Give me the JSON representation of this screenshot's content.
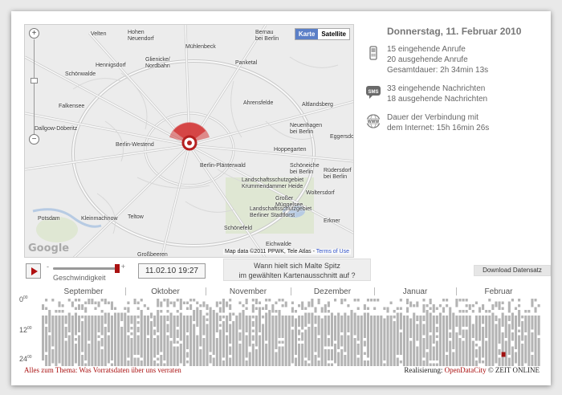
{
  "map": {
    "type_buttons": {
      "map": "Karte",
      "satellite": "Satellite"
    },
    "zoom": {
      "in": "+",
      "out": "−"
    },
    "logo": "Google",
    "attribution": "Map data ©2011 PPWK, Tele Atlas - ",
    "terms": "Terms of Use",
    "labels": [
      {
        "id": "velten",
        "text": "Velten"
      },
      {
        "id": "neuendorf",
        "text": "Hohen\nNeuendorf"
      },
      {
        "id": "muehlenbeck",
        "text": "Mühlenbeck"
      },
      {
        "id": "bernau",
        "text": "Bernau\nbei Berlin"
      },
      {
        "id": "hennigsdorf",
        "text": "Hennigsdorf"
      },
      {
        "id": "glienicke",
        "text": "Glienicke/\nNordbahn"
      },
      {
        "id": "panketal",
        "text": "Panketal"
      },
      {
        "id": "schoenwalde",
        "text": "Schönwalde"
      },
      {
        "id": "falkensee",
        "text": "Falkensee"
      },
      {
        "id": "ahrensfelde",
        "text": "Ahrensfelde"
      },
      {
        "id": "altlandsberg",
        "text": "Altlandsberg"
      },
      {
        "id": "dallgow",
        "text": "Dallgow-Döberitz"
      },
      {
        "id": "berlinwestend",
        "text": "Berlin-Westend"
      },
      {
        "id": "neuenhagen",
        "text": "Neuenhagen\nbei Berlin"
      },
      {
        "id": "eggersdorf",
        "text": "Eggersdo..."
      },
      {
        "id": "hoppegarten",
        "text": "Hoppegarten"
      },
      {
        "id": "plaenterwald",
        "text": "Berlin-Plänterwald"
      },
      {
        "id": "schoeneiche",
        "text": "Schöneiche\nbei Berlin"
      },
      {
        "id": "ruedersdorf",
        "text": "Rüdersdorf\nbei Berlin"
      },
      {
        "id": "krummendammer",
        "text": "Landschaftsschutzgebiet\nKrummendammer Heide"
      },
      {
        "id": "woltersdorf",
        "text": "Woltersdorf"
      },
      {
        "id": "mueggelsee",
        "text": "Großer\nMüggelsee"
      },
      {
        "id": "potsdam",
        "text": "Potsdam"
      },
      {
        "id": "kleinmachnow",
        "text": "Kleinmachnow"
      },
      {
        "id": "teltow",
        "text": "Teltow"
      },
      {
        "id": "stadtforst",
        "text": "Landschaftsschutzgebiet\nBerliner Stadtforst"
      },
      {
        "id": "erkner",
        "text": "Erkner"
      },
      {
        "id": "schoenefeld",
        "text": "Schönefeld"
      },
      {
        "id": "eichwalde",
        "text": "Eichwalde"
      },
      {
        "id": "grossbeeren",
        "text": "Großbeeren"
      }
    ]
  },
  "info": {
    "date": "Donnerstag, 11. Februar 2010",
    "calls": {
      "icon": "mobile-phone-icon",
      "lines": [
        "15 eingehende Anrufe",
        "20 ausgehende Anrufe",
        "Gesamtdauer: 2h 34min 13s"
      ]
    },
    "messages": {
      "icon": "sms-icon",
      "icon_text": "SMS",
      "lines": [
        "33 eingehende Nachrichten",
        "18 ausgehende Nachrichten"
      ]
    },
    "internet": {
      "icon": "globe-www-icon",
      "icon_text": "WWW",
      "lines": [
        "Dauer der Verbindung mit",
        "dem Internet: 15h 16min 26s"
      ]
    }
  },
  "controls": {
    "play_icon": "play-icon",
    "speed": {
      "minus": "-",
      "plus": "+",
      "label": "Geschwindigkeit",
      "value": 1.0
    },
    "datetime": "11.02.10 19:27",
    "question": [
      "Wann hielt sich Malte Spitz",
      "im gewählten Kartenausschnitt auf ?"
    ],
    "download": "Download  Datensatz"
  },
  "timeline": {
    "hour_labels": [
      {
        "h": "0",
        "m": "00"
      },
      {
        "h": "12",
        "m": "00"
      },
      {
        "h": "24",
        "m": "00"
      }
    ],
    "months": [
      "September",
      "Oktober",
      "November",
      "Dezember",
      "Januar",
      "Februar"
    ],
    "colors": {
      "active": "#b4b4b4",
      "empty": "#ffffff",
      "selected": "#a01010"
    }
  },
  "footer": {
    "left": "Alles zum Thema: Was Vorratsdaten über uns verraten",
    "right_prefix": "Realisierung: ",
    "right_link": "OpenDataCity",
    "right_suffix": " © ZEIT ONLINE"
  },
  "colors": {
    "accent": "#a11111",
    "marker": "#d43a3a",
    "map_button": "#5b7fc7"
  }
}
